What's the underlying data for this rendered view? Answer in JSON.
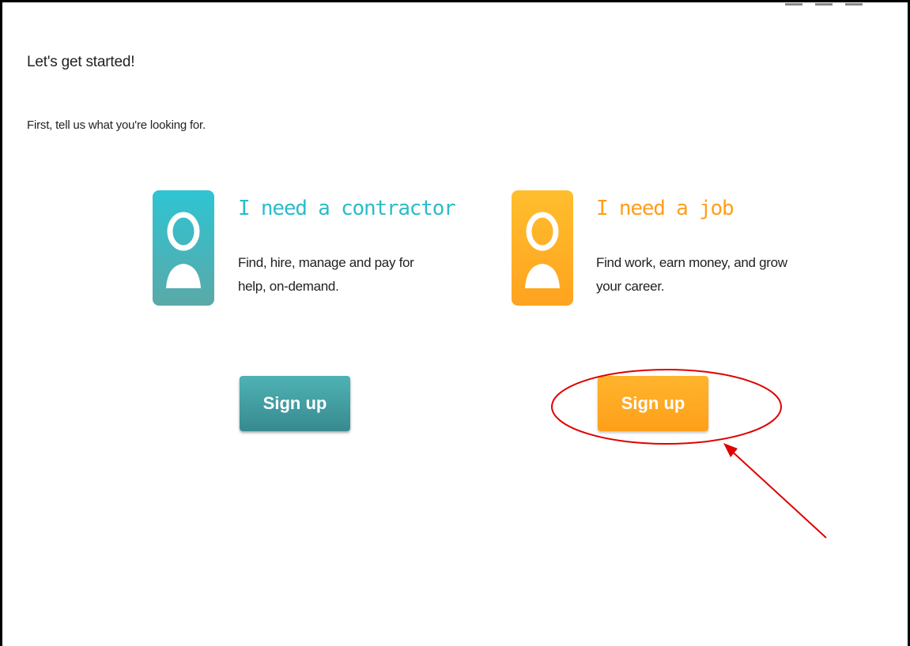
{
  "page": {
    "title": "Let's get started!",
    "subtitle": "First, tell us what you're looking for."
  },
  "options": [
    {
      "heading": "I need a contractor",
      "description": "Find, hire, manage and pay for help, on-demand.",
      "button_label": "Sign up",
      "icon": "person-icon",
      "color": "#2bbcc9"
    },
    {
      "heading": "I need a job",
      "description": "Find work, earn money, and grow your career.",
      "button_label": "Sign up",
      "icon": "person-icon",
      "color": "#ff9e1b"
    }
  ],
  "annotation": {
    "highlight_color": "#e00000",
    "target": "options.1.button_label"
  }
}
